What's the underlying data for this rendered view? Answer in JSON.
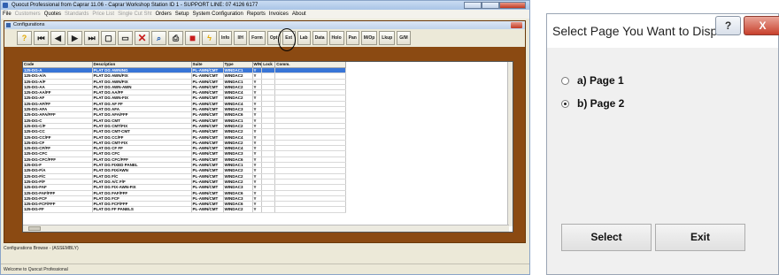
{
  "app": {
    "title": "Quocut Professional from Caprar 11.06 - Caprar Workshop Station ID 1 - SUPPORT LINE: 07 4126 6177",
    "menu": [
      {
        "label": "File",
        "disabled": false
      },
      {
        "label": "Customers",
        "disabled": true
      },
      {
        "label": "Quotes",
        "disabled": false
      },
      {
        "label": "Standards",
        "disabled": true
      },
      {
        "label": "Price List",
        "disabled": true
      },
      {
        "label": "Single Cut Sht",
        "disabled": true
      },
      {
        "label": "Orders",
        "disabled": false
      },
      {
        "label": "Setup",
        "disabled": false
      },
      {
        "label": "System Configuration",
        "disabled": false
      },
      {
        "label": "Reports",
        "disabled": false
      },
      {
        "label": "Invoices",
        "disabled": false
      },
      {
        "label": "About",
        "disabled": false
      }
    ],
    "child_title": "Configurations",
    "toolbar_text_buttons": [
      "Info",
      "I/H",
      "Form",
      "Opt",
      "Ext",
      "Lab",
      "Data",
      "Holo",
      "Pan",
      "M/Op",
      "Lkup",
      "G/M"
    ],
    "grid": {
      "columns": [
        "Code",
        "Description",
        "Suite",
        "Type",
        "W/N",
        "Lock",
        "Comm."
      ],
      "rows": [
        [
          "125-DG-A",
          "PLAT DG AWNING",
          "PL-AWN/CMT",
          "WINDAC1",
          "Y"
        ],
        [
          "125-DG-A/A",
          "PLAT DG AWN/FIX",
          "PL-AWN/CMT",
          "WINDAC2",
          "Y"
        ],
        [
          "125-DG-A/F",
          "PLAT DG AWN/FIX",
          "PL-AWN/CMT",
          "WINDAC1",
          "Y"
        ],
        [
          "125-DG-AA",
          "PLAT DG AWN-AWN",
          "PL-AWN/CMT",
          "WINDAC2",
          "Y"
        ],
        [
          "125-DG-AA/FF",
          "PLAT DG AA/FF",
          "PL-AWN/CMT",
          "WINDAC4",
          "Y"
        ],
        [
          "125-DG-AF",
          "PLAT DG AWN-FIX",
          "PL-AWN/CMT",
          "WINDAC2",
          "Y"
        ],
        [
          "125-DG-AF/FF",
          "PLAT DG AF FF",
          "PL-AWN/CMT",
          "WINDAC4",
          "Y"
        ],
        [
          "125-DG-AFA",
          "PLAT DG AFA",
          "PL-AWN/CMT",
          "WINDAC3",
          "Y"
        ],
        [
          "125-DG-AFA/FFF",
          "PLAT DG AFA/FFF",
          "PL-AWN/CMT",
          "WINDAC6",
          "Y"
        ],
        [
          "125-DG-C",
          "PLAT DG CMT",
          "PL-AWN/CMT",
          "WINDAC1",
          "Y"
        ],
        [
          "125-DG-C/F",
          "PLAT DG CMT/FIX",
          "PL-AWN/CMT",
          "WINDAC2",
          "Y"
        ],
        [
          "125-DG-CC",
          "PLAT DG CMT-CMT",
          "PL-AWN/CMT",
          "WINDAC2",
          "Y"
        ],
        [
          "125-DG-CC/FF",
          "PLAT DG CC/FF",
          "PL-AWN/CMT",
          "WINDAC4",
          "Y"
        ],
        [
          "125-DG-CF",
          "PLAT DG CMT-FIX",
          "PL-AWN/CMT",
          "WINDAC2",
          "Y"
        ],
        [
          "125-DG-CF/FF",
          "PLAT DG CF FF",
          "PL-AWN/CMT",
          "WINDAC4",
          "Y"
        ],
        [
          "125-DG-CFC",
          "PLAT DG CFC",
          "PL-AWN/CMT",
          "WINDAC3",
          "Y"
        ],
        [
          "125-DG-CFC/FFF",
          "PLAT DG CFC/FFF",
          "PL-AWN/CMT",
          "WINDAC6",
          "Y"
        ],
        [
          "125-DG-F",
          "PLAT DG FIXED PANEL",
          "PL-AWN/CMT",
          "WINDAC1",
          "Y"
        ],
        [
          "125-DG-F/A",
          "PLAT DG FIX/AWN",
          "PL-AWN/CMT",
          "WINDAC2",
          "Y"
        ],
        [
          "125-DG-F/C",
          "PLAT DG F/C",
          "PL-AWN/CMT",
          "WINDAC2",
          "Y"
        ],
        [
          "125-DG-F/F",
          "PLAT DG A/C F/F",
          "PL-AWN/CMT",
          "WINDAC2",
          "Y"
        ],
        [
          "125-DG-FAF",
          "PLAT DG FIX-AWN-FIX",
          "PL-AWN/CMT",
          "WINDAC3",
          "Y"
        ],
        [
          "125-DG-FAF/FFF",
          "PLAT DG FAF/FFF",
          "PL-AWN/CMT",
          "WINDAC6",
          "Y"
        ],
        [
          "125-DG-FCF",
          "PLAT DG FCF",
          "PL-AWN/CMT",
          "WINDAC3",
          "Y"
        ],
        [
          "125-DG-FCF/FFF",
          "PLAT DG FCF/FFF",
          "PL-AWN/CMT",
          "WINDAC6",
          "Y"
        ],
        [
          "125-DG-FF",
          "PLAT DG FF PANELS",
          "PL-AWN/CMT",
          "WINDAC2",
          "Y"
        ]
      ]
    },
    "browse_status": "Configurations Browse - (ASSEMBLY)",
    "status_bar": "Welcome to Quocut Professional"
  },
  "dialog": {
    "title": "Select Page You Want to Displa...",
    "help_label": "?",
    "close_label": "X",
    "options": [
      {
        "label": "a) Page 1",
        "selected": false
      },
      {
        "label": "b) Page 2",
        "selected": true
      }
    ],
    "select_label": "Select",
    "exit_label": "Exit"
  }
}
